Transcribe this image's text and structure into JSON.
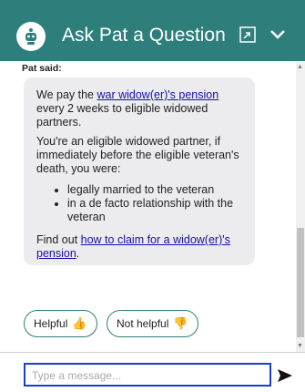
{
  "header": {
    "title": "Ask Pat a Question"
  },
  "conversation": {
    "speaker": "Pat said:",
    "para1_before": "We pay the ",
    "para1_link": "war widow(er)'s pension",
    "para1_after": " every 2 weeks to eligible widowed partners.",
    "para2": "You're an eligible widowed partner, if immediately before the eligible veteran's death, you were:",
    "bullets": [
      "legally married to the veteran",
      "in a de facto relationship with the veteran"
    ],
    "para3_before": "Find out ",
    "para3_link": "how to claim for a widow(er)'s pension",
    "para3_after": "."
  },
  "feedback": {
    "helpful_label": "Helpful",
    "not_helpful_label": "Not helpful"
  },
  "composer": {
    "placeholder": "Type a message..."
  },
  "colors": {
    "brand": "#2e7f7b",
    "link": "#1a0dab",
    "input_border": "#1a3fc8"
  },
  "icons": [
    "robot-avatar-icon",
    "expand-icon",
    "chevron-down-icon",
    "thumbs-up-icon",
    "thumbs-down-icon",
    "send-icon"
  ]
}
